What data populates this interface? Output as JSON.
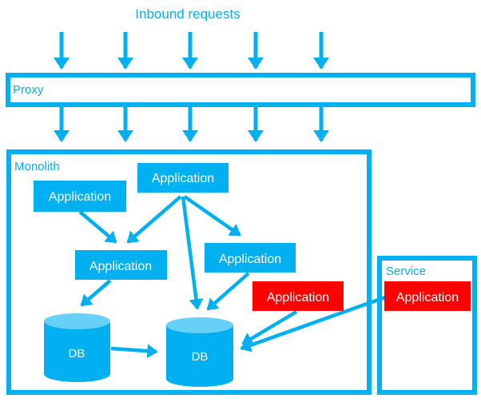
{
  "colors": {
    "accent": "#00B0F0",
    "db_top": "#66D0F7",
    "legacy": "#FF0000",
    "text_on_box": "#FFFFFF",
    "background": "#FFFFFF"
  },
  "title": "Inbound requests",
  "proxy": {
    "label": "Proxy"
  },
  "monolith": {
    "label": "Monolith",
    "applications": [
      {
        "id": "app-left",
        "label": "Application",
        "status": "normal"
      },
      {
        "id": "app-top",
        "label": "Application",
        "status": "normal"
      },
      {
        "id": "app-middle",
        "label": "Application",
        "status": "normal"
      },
      {
        "id": "app-right",
        "label": "Application",
        "status": "normal"
      },
      {
        "id": "app-extracted",
        "label": "Application",
        "status": "legacy"
      }
    ],
    "databases": [
      {
        "id": "db-left",
        "label": "DB"
      },
      {
        "id": "db-right",
        "label": "DB"
      }
    ]
  },
  "service": {
    "label": "Service",
    "application": {
      "id": "app-service",
      "label": "Application",
      "status": "legacy"
    }
  },
  "connections": [
    {
      "from": "inbound",
      "to": "proxy",
      "count": 5
    },
    {
      "from": "proxy",
      "to": "monolith",
      "count": 5
    },
    {
      "from": "app-left",
      "to": "app-middle"
    },
    {
      "from": "app-top",
      "to": "app-middle"
    },
    {
      "from": "app-top",
      "to": "app-right"
    },
    {
      "from": "app-top",
      "to": "db-right"
    },
    {
      "from": "app-middle",
      "to": "db-left"
    },
    {
      "from": "app-right",
      "to": "db-right"
    },
    {
      "from": "app-extracted",
      "to": "db-right"
    },
    {
      "from": "app-service",
      "to": "db-right"
    },
    {
      "from": "db-left",
      "to": "db-right"
    }
  ]
}
